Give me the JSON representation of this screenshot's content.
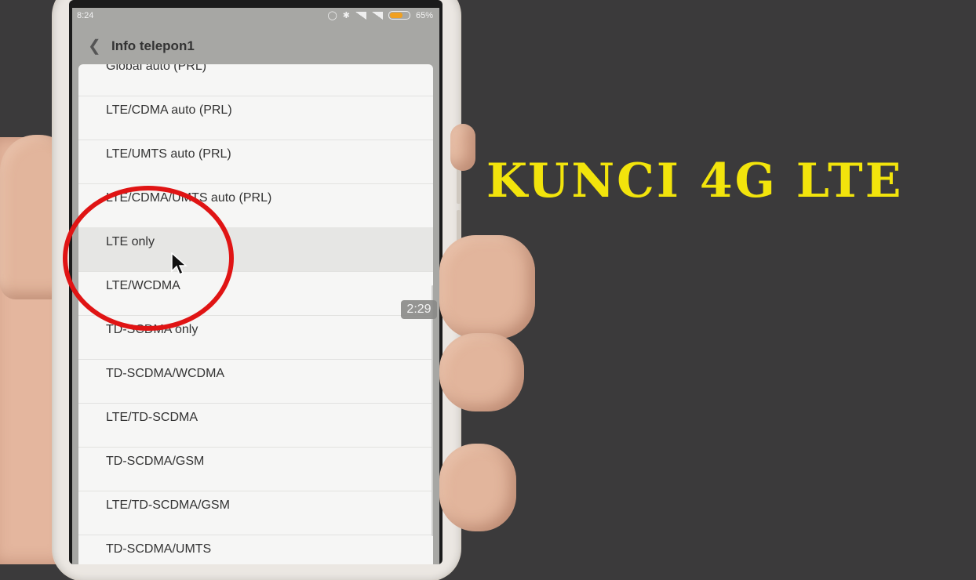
{
  "status_bar": {
    "time": "8:24",
    "battery": "65%"
  },
  "header": {
    "title": "Info telepon1"
  },
  "network_modes": [
    "Global auto (PRL)",
    "LTE/CDMA auto (PRL)",
    "LTE/UMTS auto (PRL)",
    "LTE/CDMA/UMTS auto (PRL)",
    "LTE only",
    "LTE/WCDMA",
    "TD-SCDMA only",
    "TD-SCDMA/WCDMA",
    "LTE/TD-SCDMA",
    "TD-SCDMA/GSM",
    "LTE/TD-SCDMA/GSM",
    "TD-SCDMA/UMTS"
  ],
  "highlighted_mode": "LTE only",
  "video_time": "2:29",
  "headline": "KUNCI 4G LTE",
  "colors": {
    "headline": "#f2e40c",
    "circle": "#e01414",
    "battery": "#f0a020"
  }
}
